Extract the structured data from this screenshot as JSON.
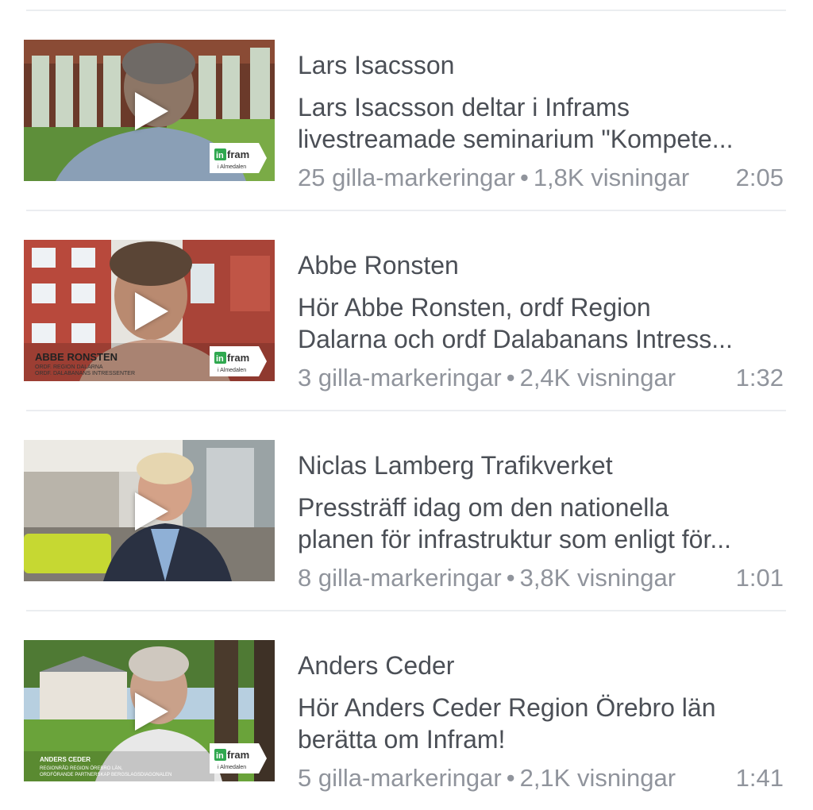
{
  "videos": [
    {
      "title": "Lars Isacsson",
      "desc_line1": "Lars Isacsson deltar i Inframs",
      "desc_line2": "livestreamade seminarium \"Kompete...",
      "likes": "25 gilla-markeringar",
      "separator": "•",
      "views": "1,8K visningar",
      "duration": "2:05",
      "overlay_caption": "",
      "badge_brand": "infram",
      "badge_sub": "i Almedalen"
    },
    {
      "title": "Abbe Ronsten",
      "desc_line1": "Hör Abbe Ronsten, ordf Region",
      "desc_line2": "Dalarna och ordf Dalabanans Intress...",
      "likes": "3 gilla-markeringar",
      "separator": "•",
      "views": "2,4K visningar",
      "duration": "1:32",
      "overlay_caption": "ABBE RONSTEN",
      "overlay_sub1": "ORDF. REGION DALARNA",
      "overlay_sub2": "ORDF. DALABANANS INTRESSENTER",
      "badge_brand": "infram",
      "badge_sub": "i Almedalen"
    },
    {
      "title": "Niclas Lamberg Trafikverket",
      "desc_line1": "Pressträff idag om den nationella",
      "desc_line2": "planen för infrastruktur som enligt för...",
      "likes": "8 gilla-markeringar",
      "separator": "•",
      "views": "3,8K visningar",
      "duration": "1:01"
    },
    {
      "title": "Anders Ceder",
      "desc_line1": "Hör Anders Ceder Region Örebro län",
      "desc_line2": "berätta om Infram!",
      "likes": "5 gilla-markeringar",
      "separator": "•",
      "views": "2,1K visningar",
      "duration": "1:41",
      "overlay_caption": "ANDERS CEDER",
      "overlay_sub1": "REGIONRÅD REGION ÖREBRO LÄN,",
      "overlay_sub2": "ORDFÖRANDE PARTNERSKAP BERGSLAGSDIAGONALEN",
      "badge_brand": "infram",
      "badge_sub": "i Almedalen"
    }
  ],
  "colors": {
    "title_text": "#4b4f56",
    "meta_text": "#90949c",
    "divider": "#ebedf0",
    "badge_green": "#2fa84f"
  }
}
